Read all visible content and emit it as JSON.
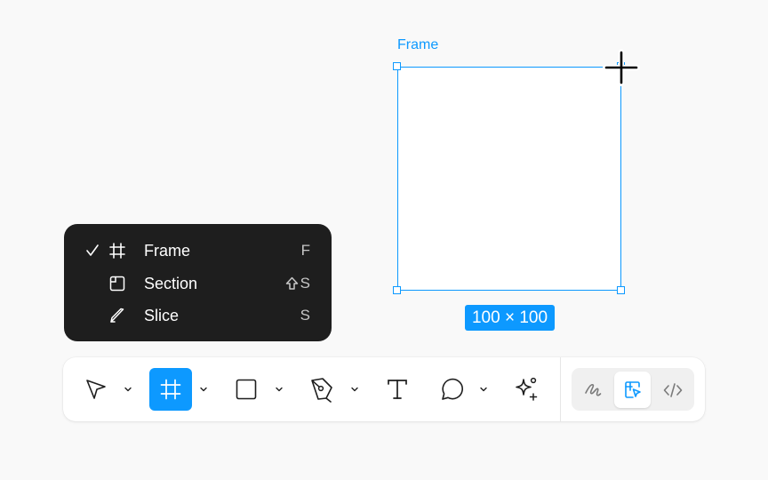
{
  "canvas": {
    "frame_name": "Frame",
    "size_badge": "100 × 100"
  },
  "menu": {
    "items": [
      {
        "label": "Frame",
        "shortcut": "F",
        "checked": true,
        "icon": "frame-icon"
      },
      {
        "label": "Section",
        "shortcut": "S",
        "shortcut_modifier": "shift-icon",
        "checked": false,
        "icon": "section-icon"
      },
      {
        "label": "Slice",
        "shortcut": "S",
        "checked": false,
        "icon": "slice-icon"
      }
    ]
  },
  "toolbar": {
    "tools": [
      {
        "name": "move",
        "icon": "move-cursor-icon",
        "has_dropdown": true
      },
      {
        "name": "frame",
        "icon": "frame-icon",
        "has_dropdown": true,
        "active": true
      },
      {
        "name": "shape",
        "icon": "rectangle-icon",
        "has_dropdown": true
      },
      {
        "name": "pen",
        "icon": "pen-icon",
        "has_dropdown": true
      },
      {
        "name": "text",
        "icon": "text-icon",
        "has_dropdown": false
      },
      {
        "name": "comment",
        "icon": "comment-icon",
        "has_dropdown": true
      },
      {
        "name": "actions",
        "icon": "sparkle-icon",
        "has_dropdown": false
      }
    ],
    "modes": [
      {
        "name": "draw",
        "icon": "draw-squiggle-icon"
      },
      {
        "name": "design",
        "icon": "design-mode-icon",
        "active": true
      },
      {
        "name": "dev",
        "icon": "code-icon"
      }
    ]
  },
  "colors": {
    "accent": "#0d99ff",
    "menu_bg": "#1e1e1e",
    "canvas_bg": "#f9f9f9"
  }
}
